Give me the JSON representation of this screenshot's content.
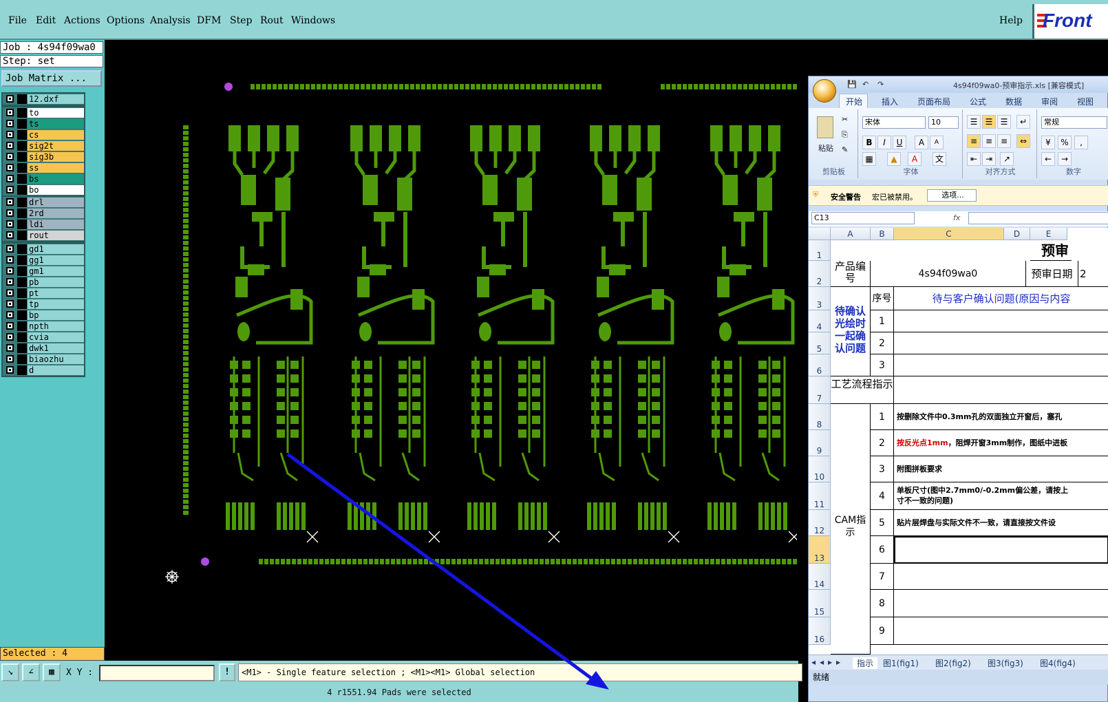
{
  "menu": {
    "items": [
      "File",
      "Edit",
      "Actions",
      "Options",
      "Analysis",
      "DFM",
      "Step",
      "Rout",
      "Windows"
    ],
    "help": "Help",
    "logo_text": "Front"
  },
  "left_panel": {
    "job": "Job : 4s94f09wa0",
    "step": "Step: set",
    "job_matrix": "Job Matrix ...",
    "groups": [
      [
        {
          "name": "12.dxf",
          "color": "#93d5d5"
        }
      ],
      [
        {
          "name": "to",
          "color": "#ffffff"
        },
        {
          "name": "ts",
          "color": "#1a9c7f"
        },
        {
          "name": "cs",
          "color": "#f6c54f"
        },
        {
          "name": "sig2t",
          "color": "#f6c54f"
        },
        {
          "name": "sig3b",
          "color": "#f6c54f"
        },
        {
          "name": "ss",
          "color": "#f6c54f"
        },
        {
          "name": "bs",
          "color": "#1a9c7f"
        },
        {
          "name": "bo",
          "color": "#ffffff"
        }
      ],
      [
        {
          "name": "drl",
          "color": "#9fb4c0"
        },
        {
          "name": "2rd",
          "color": "#9fb4c0"
        },
        {
          "name": "ldi",
          "color": "#9fb4c0"
        },
        {
          "name": "rout",
          "color": "#d4d4d4"
        }
      ],
      [
        {
          "name": "gd1",
          "color": "#93d5d5"
        },
        {
          "name": "gg1",
          "color": "#93d5d5"
        },
        {
          "name": "gm1",
          "color": "#93d5d5"
        },
        {
          "name": "pb",
          "color": "#93d5d5"
        },
        {
          "name": "pt",
          "color": "#93d5d5"
        },
        {
          "name": "tp",
          "color": "#93d5d5"
        },
        {
          "name": "bp",
          "color": "#93d5d5"
        },
        {
          "name": "npth",
          "color": "#93d5d5"
        },
        {
          "name": "cvia",
          "color": "#93d5d5"
        },
        {
          "name": "dwk1",
          "color": "#93d5d5"
        },
        {
          "name": "biaozhu",
          "color": "#93d5d5"
        },
        {
          "name": "d",
          "color": "#93d5d5"
        }
      ]
    ],
    "selected": "Selected : 4"
  },
  "bottom": {
    "xy_label": "X Y :",
    "bang": "!",
    "hint": "<M1> - Single feature selection ; <M1><M1> Global selection",
    "status": "4 r1551.94 Pads were selected"
  },
  "colors": {
    "pcb_green": "#4f9a0a",
    "arrow": "#1515e0",
    "marker": "#b04adf"
  },
  "excel": {
    "title": "4s94f09wa0-预审指示.xls [兼容模式]",
    "tabs": [
      "开始",
      "插入",
      "页面布局",
      "公式",
      "数据",
      "审阅",
      "视图"
    ],
    "clipboard_label": "剪贴板",
    "paste": "粘贴",
    "font_label": "字体",
    "align_label": "对齐方式",
    "number_label": "数字",
    "font_name": "宋体",
    "font_size": "10",
    "number_format": "常规",
    "security_warning": "安全警告",
    "security_msg": "宏已被禁用。",
    "options_btn": "选项...",
    "name_box": "C13",
    "fx": "fx",
    "columns": [
      "A",
      "B",
      "C",
      "D",
      "E"
    ],
    "rows": [
      "1",
      "2",
      "3",
      "4",
      "5",
      "6",
      "7",
      "8",
      "9",
      "10",
      "11",
      "12",
      "13",
      "14",
      "15",
      "16"
    ],
    "title_cell": "预审",
    "product_label": "产品编号",
    "product_value": "4s94f09wa0",
    "review_date": "预审日期",
    "review_date_tail": "2",
    "seq_label": "序号",
    "confirm_header": "待与客户确认问题(原因与内容",
    "confirm_label": "待确认光绘时一起确认问题",
    "process_label": "工艺流程指示",
    "cam_label": "CAM指示",
    "confirm_nums": [
      "1",
      "2",
      "3"
    ],
    "cam_nums": [
      "1",
      "2",
      "3",
      "4",
      "5",
      "6",
      "7",
      "8",
      "9"
    ],
    "cam_texts": [
      {
        "red": "",
        "text": "按删除文件中0.3mm孔的双面独立开窗后，塞孔"
      },
      {
        "red": "按反光点1mm",
        "text": "，阻焊开窗3mm制作，图纸中进板"
      },
      {
        "red": "",
        "text": "附图拼板要求"
      },
      {
        "red": "",
        "text": "单板尺寸(图中2.7mm0/-0.2mm偏公差，请按上\n寸不一致的问题)"
      },
      {
        "red": "",
        "text": "贴片层焊盘与实际文件不一致，请直接按文件设"
      }
    ],
    "sheet_tabs": [
      "指示",
      "图1(fig1)",
      "图2(fig2)",
      "图3(fig3)",
      "图4(fig4)"
    ],
    "status": "就绪"
  }
}
